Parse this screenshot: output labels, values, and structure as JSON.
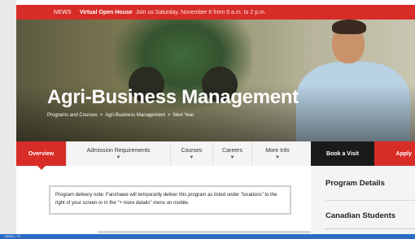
{
  "announcement": {
    "tag": "NEWS",
    "title": "Virtual Open House",
    "text": "Join us Saturday, November 6 from 9 a.m. to 2 p.m."
  },
  "hero": {
    "title": "Agri-Business Management",
    "breadcrumb": [
      "Programs and Courses",
      ">",
      "Agri-Business Management",
      ">",
      "Next Year"
    ]
  },
  "tabs": [
    {
      "label": "Overview",
      "active": true
    },
    {
      "label": "Admission Requirements"
    },
    {
      "label": "Courses"
    },
    {
      "label": "Careers"
    },
    {
      "label": "More Info"
    }
  ],
  "actions": {
    "visit_label": "Book a Visit",
    "apply_label": "Apply"
  },
  "notice": {
    "text": "Program delivery note: Fanshawe will temporarily deliver this program as listed under \"locations\" to the right of your screen or in the \"+ more details\" menu on mobile."
  },
  "sidebar": {
    "heading": "Program Details",
    "subheading": "Canadian Students"
  },
  "status_bar": {
    "text": "DEMO: 73"
  },
  "colors": {
    "brand_red": "#d82c27",
    "dark": "#1a1a1a",
    "status_blue": "#2a6cc4"
  },
  "icons": {
    "tab_dropdown": "chevron-down-icon"
  }
}
